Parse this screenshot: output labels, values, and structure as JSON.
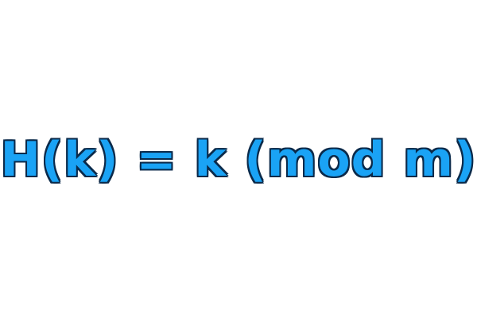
{
  "formula": {
    "text": "H(k) = k (mod m)",
    "fill_color": "#1aa3f5",
    "outline_color": "#0b2a4a"
  },
  "background_color": "#ffffff"
}
